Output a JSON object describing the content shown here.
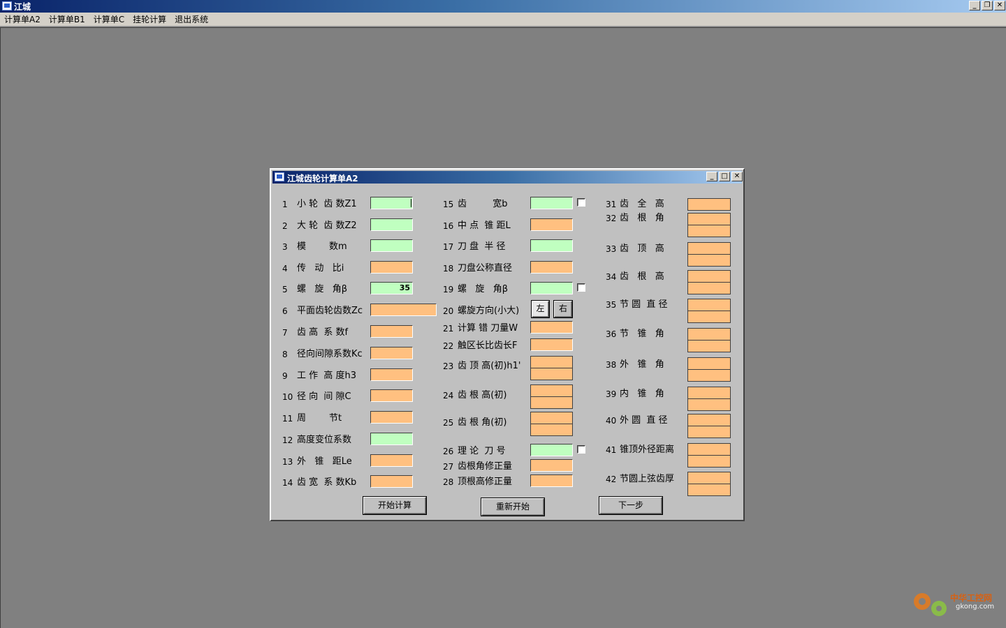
{
  "app": {
    "title": "江城",
    "menu": [
      "计算单A2",
      "计算单B1",
      "计算单C",
      "挂轮计算",
      "退出系统"
    ]
  },
  "dialog": {
    "title": "江城齿轮计算单A2",
    "col1": [
      {
        "n": "1",
        "label": "小 轮  齿 数Z1",
        "value": "",
        "color": "g"
      },
      {
        "n": "2",
        "label": "大 轮  齿 数Z2",
        "value": "",
        "color": "g"
      },
      {
        "n": "3",
        "label": "模        数m",
        "value": "",
        "color": "g"
      },
      {
        "n": "4",
        "label": "传   动   比i",
        "value": "",
        "color": "o"
      },
      {
        "n": "5",
        "label": "螺   旋   角β",
        "value": "35",
        "color": "g"
      },
      {
        "n": "6",
        "label": "平面齿轮齿数Zc",
        "value": "",
        "color": "o"
      },
      {
        "n": "7",
        "label": "齿 高  系 数f",
        "value": "",
        "color": "o"
      },
      {
        "n": "8",
        "label": "径向间隙系数Kc",
        "value": "",
        "color": "o"
      },
      {
        "n": "9",
        "label": "工 作  高 度h3",
        "value": "",
        "color": "o"
      },
      {
        "n": "10",
        "label": "径 向  间 隙C",
        "value": "",
        "color": "o"
      },
      {
        "n": "11",
        "label": "周        节t",
        "value": "",
        "color": "o"
      },
      {
        "n": "12",
        "label": "高度变位系数",
        "value": "",
        "color": "g"
      },
      {
        "n": "13",
        "label": "外   锥   距Le",
        "value": "",
        "color": "o"
      },
      {
        "n": "14",
        "label": "齿 宽  系 数Kb",
        "value": "",
        "color": "o"
      }
    ],
    "col2": [
      {
        "n": "15",
        "label": "齿         宽b",
        "value": "",
        "color": "g"
      },
      {
        "n": "16",
        "label": "中 点  锥 距L",
        "value": "",
        "color": "o"
      },
      {
        "n": "17",
        "label": "刀 盘  半 径",
        "value": "",
        "color": "g"
      },
      {
        "n": "18",
        "label": "刀盘公称直径",
        "value": "",
        "color": "o"
      },
      {
        "n": "19",
        "label": "螺   旋   角β",
        "value": "",
        "color": "g"
      },
      {
        "n": "20",
        "label": "螺旋方向(小大)",
        "value": "",
        "color": ""
      },
      {
        "n": "21",
        "label": "计算 错 刀量W",
        "value": "",
        "color": "o"
      },
      {
        "n": "22",
        "label": "触区长比齿长F",
        "value": "",
        "color": "o"
      },
      {
        "n": "23",
        "label": "齿 顶 高(初)h1'",
        "value": "",
        "color": "o"
      },
      {
        "n": "24",
        "label": "齿 根 高(初)",
        "value": "",
        "color": "o"
      },
      {
        "n": "25",
        "label": "齿 根 角(初)",
        "value": "",
        "color": "o"
      },
      {
        "n": "26",
        "label": "理 论  刀 号",
        "value": "",
        "color": "g"
      },
      {
        "n": "27",
        "label": "齿根角修正量",
        "value": "",
        "color": "o"
      },
      {
        "n": "28",
        "label": "顶根高修正量",
        "value": "",
        "color": "o"
      }
    ],
    "col3": [
      {
        "n": "31",
        "label": "齿   全   高"
      },
      {
        "n": "32",
        "label": "齿   根   角"
      },
      {
        "n": "33",
        "label": "齿   顶   高"
      },
      {
        "n": "34",
        "label": "齿   根   高"
      },
      {
        "n": "35",
        "label": "节 圆  直 径"
      },
      {
        "n": "36",
        "label": "节   锥   角"
      },
      {
        "n": "38",
        "label": "外   锥   角"
      },
      {
        "n": "39",
        "label": "内   锥   角"
      },
      {
        "n": "40",
        "label": "外 圆  直 径"
      },
      {
        "n": "41",
        "label": "锥顶外径距离"
      },
      {
        "n": "42",
        "label": "节圆上弦齿厚"
      }
    ],
    "dir_left": "左",
    "dir_right": "右",
    "btn_start": "开始计算",
    "btn_restart": "重新开始",
    "btn_next": "下一步"
  },
  "watermark": {
    "cn": "中华工控网",
    "url": "gkong.com"
  }
}
